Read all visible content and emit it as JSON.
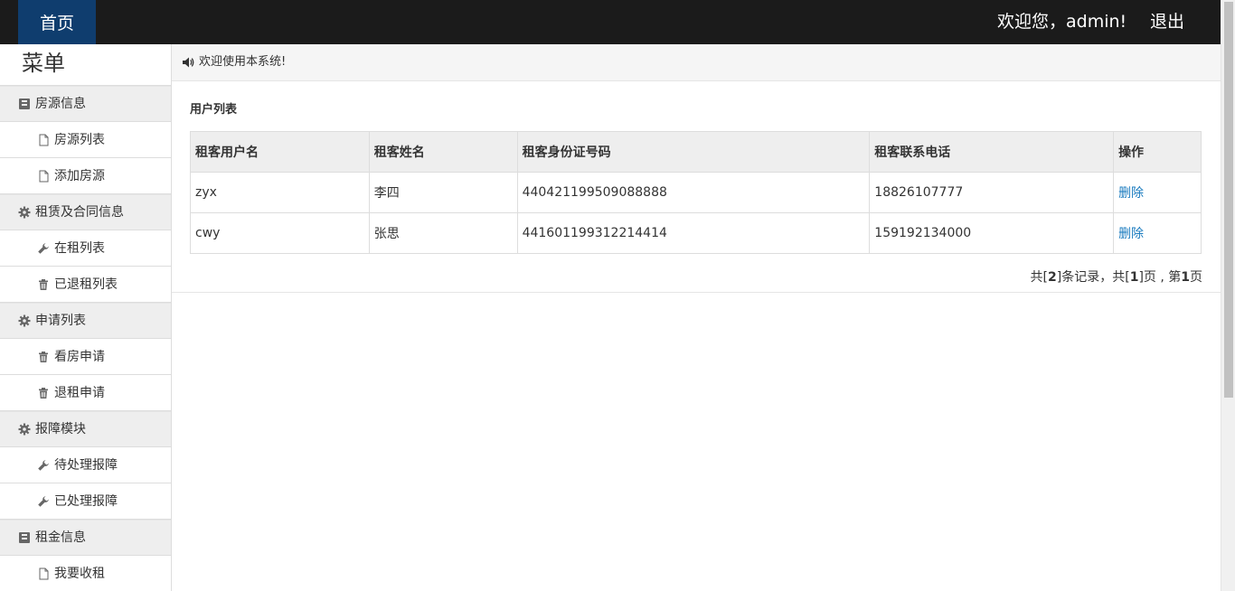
{
  "navbar": {
    "home_label": "首页",
    "welcome_text": "欢迎您，admin!",
    "logout_label": "退出"
  },
  "sidebar": {
    "title": "菜单",
    "groups": [
      {
        "label": "房源信息",
        "icon": "book-icon",
        "items": [
          {
            "label": "房源列表",
            "icon": "file-icon"
          },
          {
            "label": "添加房源",
            "icon": "file-icon"
          }
        ]
      },
      {
        "label": "租赁及合同信息",
        "icon": "cog-icon",
        "items": [
          {
            "label": "在租列表",
            "icon": "wrench-icon"
          },
          {
            "label": "已退租列表",
            "icon": "trash-icon"
          }
        ]
      },
      {
        "label": "申请列表",
        "icon": "cog-icon",
        "items": [
          {
            "label": "看房申请",
            "icon": "trash-icon"
          },
          {
            "label": "退租申请",
            "icon": "trash-icon"
          }
        ]
      },
      {
        "label": "报障模块",
        "icon": "cog-icon",
        "items": [
          {
            "label": "待处理报障",
            "icon": "wrench-icon"
          },
          {
            "label": "已处理报障",
            "icon": "wrench-icon"
          }
        ]
      },
      {
        "label": "租金信息",
        "icon": "book-icon",
        "items": [
          {
            "label": "我要收租",
            "icon": "file-icon"
          }
        ]
      }
    ]
  },
  "main": {
    "notice": "欢迎使用本系统!",
    "panel_title": "用户列表",
    "table": {
      "headers": [
        "租客用户名",
        "租客姓名",
        "租客身份证号码",
        "租客联系电话",
        "操作"
      ],
      "rows": [
        {
          "username": "zyx",
          "name": "李四",
          "id_number": "440421199509088888",
          "phone": "18826107777",
          "action": "删除"
        },
        {
          "username": "cwy",
          "name": "张思",
          "id_number": "441601199312214414",
          "phone": "159192134000",
          "action": "删除"
        }
      ]
    },
    "pager": {
      "p1": "共[",
      "total_records": "2",
      "p2": "]条记录，共[",
      "total_pages": "1",
      "p3": "]页 , 第",
      "current_page": "1",
      "p4": "页"
    }
  },
  "colors": {
    "navbar_bg": "#1b1b1b",
    "home_active_bg": "#0f3d6e",
    "link": "#1a7bbf"
  }
}
